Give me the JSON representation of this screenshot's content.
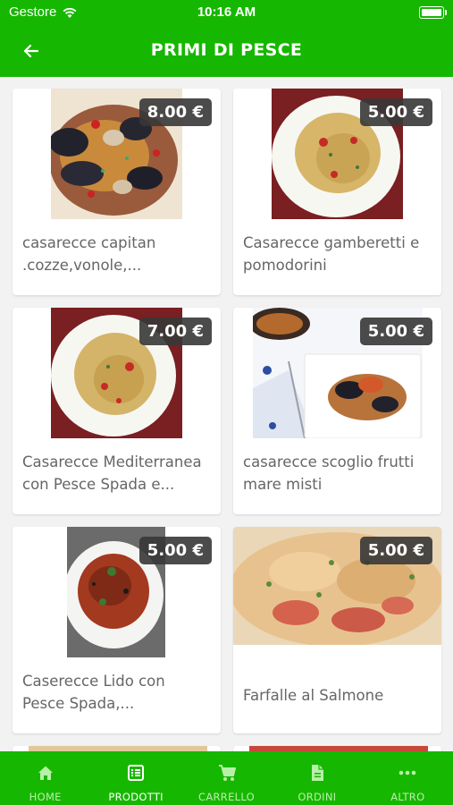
{
  "status": {
    "carrier": "Gestore",
    "time": "10:16 AM"
  },
  "header": {
    "title": "PRIMI DI PESCE"
  },
  "products": [
    {
      "name": "casarecce capitan .cozze,vonole,...",
      "price": "8.00 €"
    },
    {
      "name": "Casarecce gamberetti e pomodorini",
      "price": "5.00 €"
    },
    {
      "name": "Casarecce Mediterranea con Pesce Spada e...",
      "price": "7.00 €"
    },
    {
      "name": "casarecce scoglio frutti mare misti",
      "price": "5.00 €"
    },
    {
      "name": "Caserecce Lido con Pesce Spada,...",
      "price": "5.00 €"
    },
    {
      "name": "Farfalle al Salmone",
      "price": "5.00 €"
    }
  ],
  "tabs": [
    {
      "label": "HOME",
      "icon": "home-icon",
      "active": false
    },
    {
      "label": "PRODOTTI",
      "icon": "list-icon",
      "active": true
    },
    {
      "label": "CARRELLO",
      "icon": "cart-icon",
      "active": false
    },
    {
      "label": "ORDINI",
      "icon": "document-icon",
      "active": false
    },
    {
      "label": "ALTRO",
      "icon": "more-icon",
      "active": false
    }
  ],
  "colors": {
    "brand": "#16b700",
    "price_badge": "#373737"
  }
}
